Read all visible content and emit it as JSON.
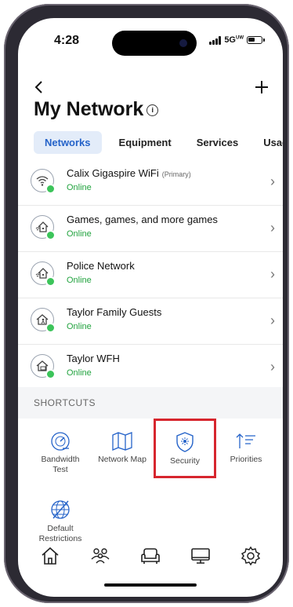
{
  "status_bar": {
    "time": "4:28",
    "network": "5G",
    "network_sup": "UW"
  },
  "header": {
    "title": "My Network",
    "info_icon": "info-icon",
    "back_icon": "chevron-left-icon",
    "add_icon": "plus-icon"
  },
  "tabs": [
    {
      "label": "Networks",
      "active": true
    },
    {
      "label": "Equipment",
      "active": false
    },
    {
      "label": "Services",
      "active": false
    },
    {
      "label": "Usage",
      "active": false
    }
  ],
  "networks": [
    {
      "name": "Calix Gigaspire WiFi",
      "tag": "(Primary)",
      "status": "Online",
      "icon": "wifi-icon"
    },
    {
      "name": "Games, games, and more games",
      "tag": "",
      "status": "Online",
      "icon": "home-wifi-icon"
    },
    {
      "name": "Police Network",
      "tag": "",
      "status": "Online",
      "icon": "home-wifi-icon"
    },
    {
      "name": "Taylor Family Guests",
      "tag": "",
      "status": "Online",
      "icon": "home-guest-icon"
    },
    {
      "name": "Taylor WFH",
      "tag": "",
      "status": "Online",
      "icon": "home-work-icon"
    }
  ],
  "shortcuts": {
    "heading": "SHORTCUTS",
    "items": [
      {
        "label": "Bandwidth Test",
        "icon": "speedometer-icon"
      },
      {
        "label": "Network Map",
        "icon": "map-icon"
      },
      {
        "label": "Security",
        "icon": "shield-icon"
      },
      {
        "label": "Priorities",
        "icon": "priority-icon"
      },
      {
        "label": "Default Restrictions",
        "icon": "globe-blocked-icon"
      }
    ]
  },
  "bottom_nav": [
    {
      "label": "Home",
      "icon": "home-icon"
    },
    {
      "label": "People",
      "icon": "people-icon"
    },
    {
      "label": "Things",
      "icon": "sofa-icon"
    },
    {
      "label": "Devices",
      "icon": "monitor-icon"
    },
    {
      "label": "Settings",
      "icon": "gear-icon"
    }
  ],
  "colors": {
    "accent": "#2563c9",
    "online": "#22a33f",
    "highlight": "#d7262e"
  }
}
